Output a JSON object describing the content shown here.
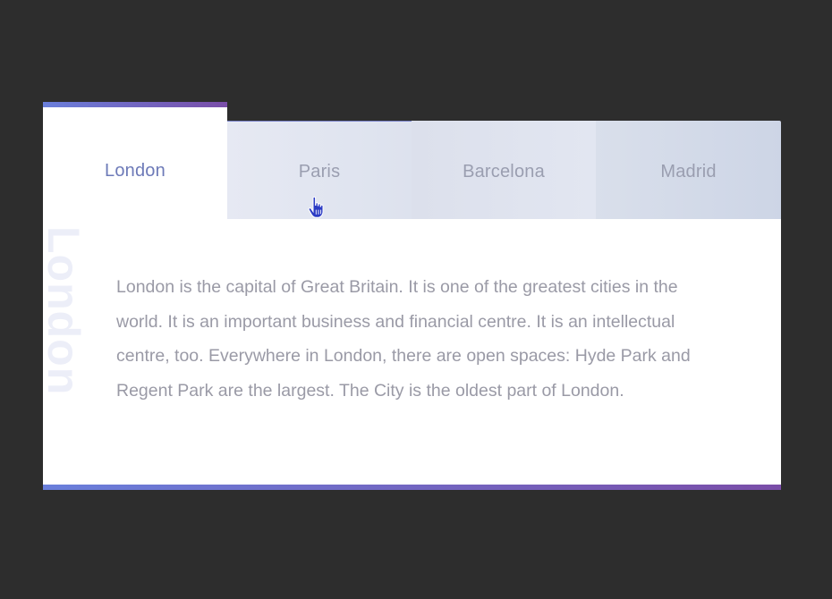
{
  "tabs": [
    {
      "label": "London",
      "active": true
    },
    {
      "label": "Paris",
      "active": false
    },
    {
      "label": "Barcelona",
      "active": false
    },
    {
      "label": "Madrid",
      "active": false
    }
  ],
  "panel": {
    "watermark": "London",
    "text": "London is the capital of Great Britain. It is one of the greatest cities in the world. It is an important business and financial centre. It is an intellectual centre, too. Everywhere in London, there are open spaces: Hyde Park and Regent Park are the largest. The City is the oldest part of London."
  },
  "colors": {
    "background": "#2d2d2d",
    "accent_start": "#6a7fdb",
    "accent_end": "#7a4ea8",
    "active_tab_text": "#6d7ab8",
    "inactive_tab_text": "#9a9eb0",
    "body_text": "#9a9aa6",
    "watermark": "#eceef8"
  },
  "icons": {
    "cursor": "hand-pointer-icon"
  }
}
